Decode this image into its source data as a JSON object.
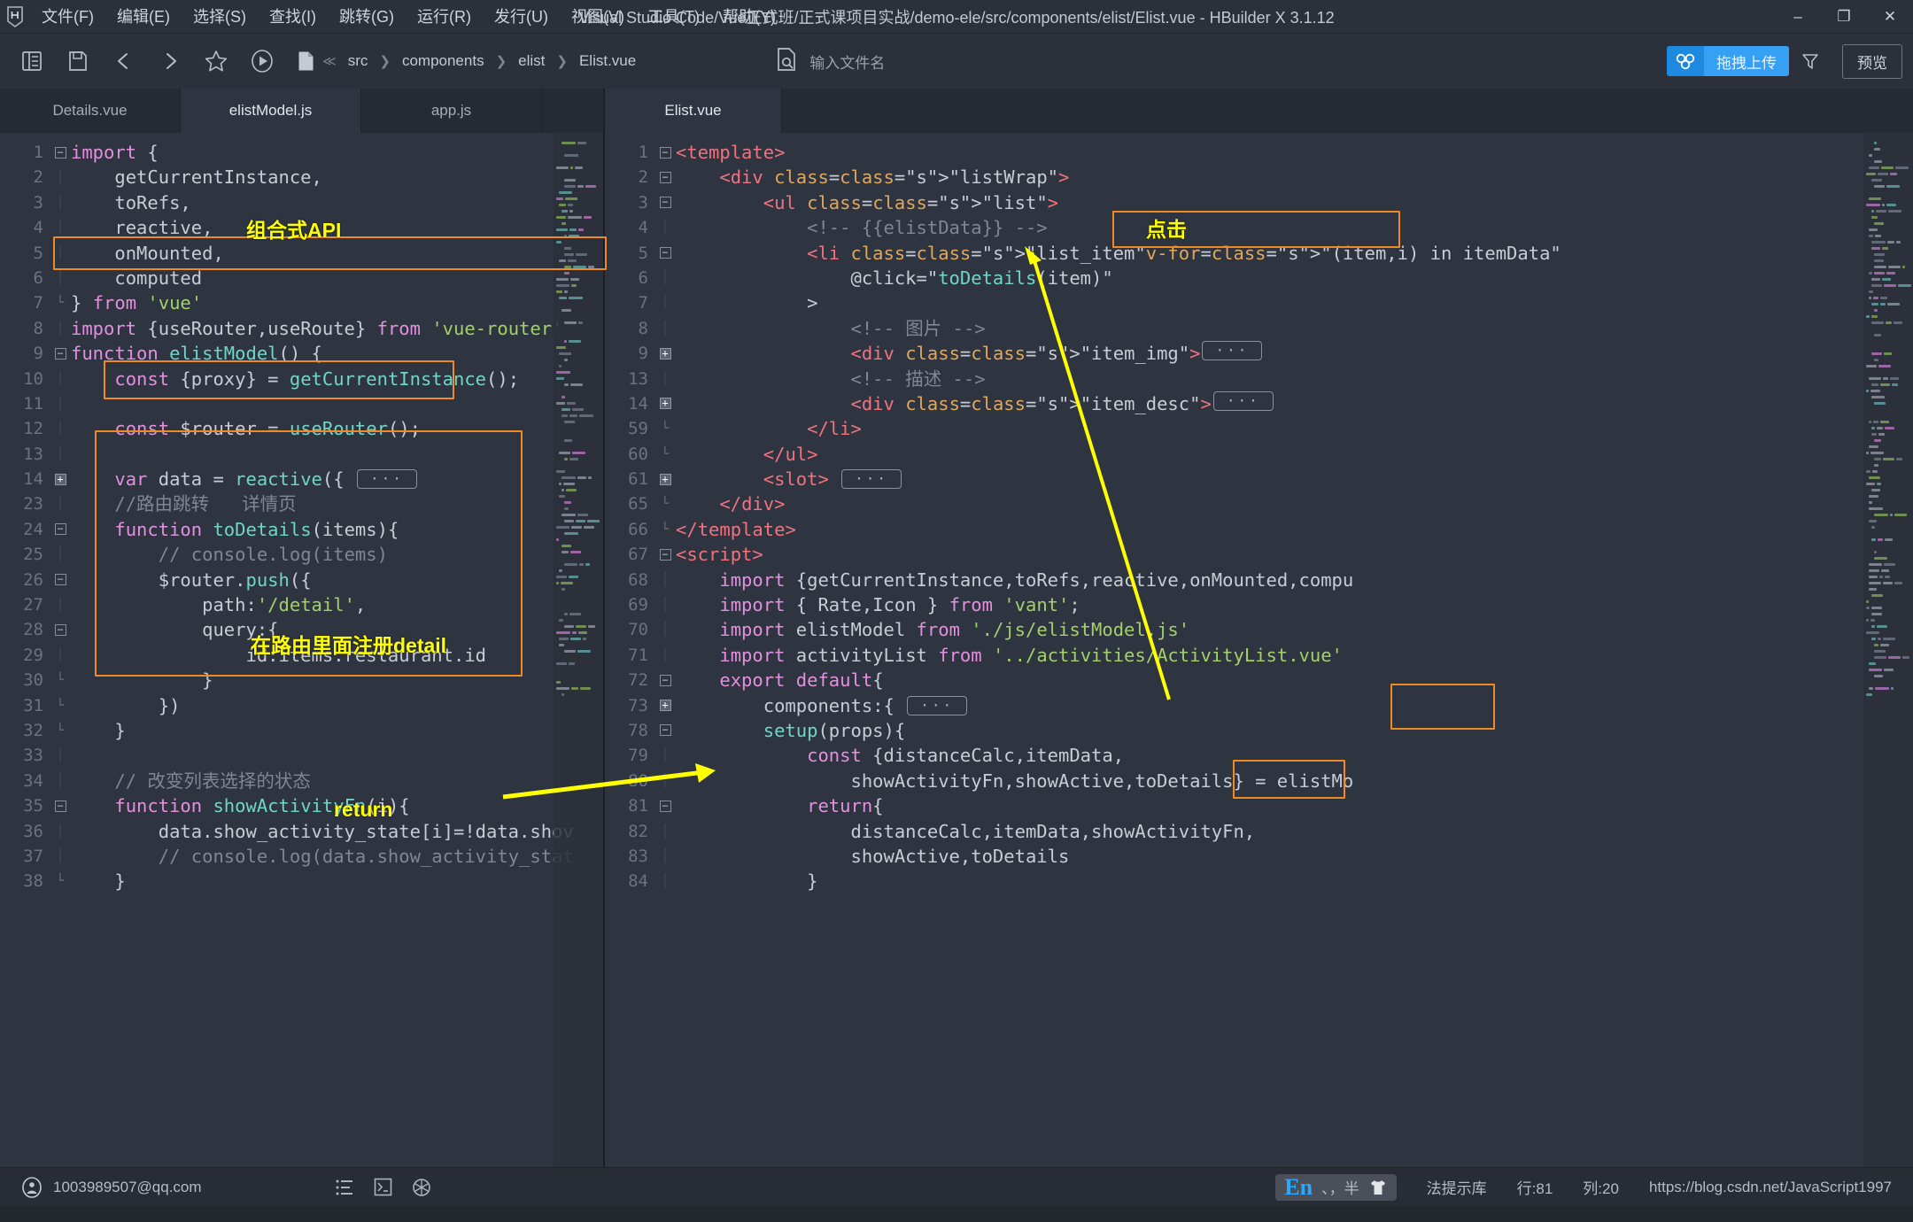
{
  "window": {
    "title": "Visual Studio Code/Vue正式班/正式课项目实战/demo-ele/src/components/elist/Elist.vue - HBuilder X 3.1.12",
    "minimize": "–",
    "maximize": "❐",
    "close": "✕"
  },
  "menu": [
    {
      "label": "文件(F)"
    },
    {
      "label": "编辑(E)"
    },
    {
      "label": "选择(S)"
    },
    {
      "label": "查找(I)"
    },
    {
      "label": "跳转(G)"
    },
    {
      "label": "运行(R)"
    },
    {
      "label": "发行(U)"
    },
    {
      "label": "视图(V)"
    },
    {
      "label": "工具(T)"
    },
    {
      "label": "帮助(Y)"
    }
  ],
  "toolbar": {
    "breadcrumb": [
      "src",
      "components",
      "elist",
      "Elist.vue"
    ],
    "breadcrumb_prefix": "≪",
    "search_placeholder": "输入文件名",
    "upload_label": "拖拽上传",
    "preview_label": "预览"
  },
  "left_pane": {
    "tabs": [
      {
        "label": "Details.vue",
        "active": false
      },
      {
        "label": "elistModel.js",
        "active": true
      },
      {
        "label": "app.js",
        "active": false
      }
    ],
    "lines": [
      {
        "n": "1",
        "fold": "minus",
        "code": "import {"
      },
      {
        "n": "2",
        "fold": "",
        "code": "    getCurrentInstance,"
      },
      {
        "n": "3",
        "fold": "",
        "code": "    toRefs,"
      },
      {
        "n": "4",
        "fold": "",
        "code": "    reactive,"
      },
      {
        "n": "5",
        "fold": "",
        "code": "    onMounted,"
      },
      {
        "n": "6",
        "fold": "",
        "code": "    computed"
      },
      {
        "n": "7",
        "fold": "end",
        "code": "} from 'vue'"
      },
      {
        "n": "8",
        "fold": "",
        "code": "import {useRouter,useRoute} from 'vue-router'"
      },
      {
        "n": "9",
        "fold": "minus",
        "code": "function elistModel() {"
      },
      {
        "n": "10",
        "fold": "",
        "code": "    const {proxy} = getCurrentInstance();"
      },
      {
        "n": "11",
        "fold": "",
        "code": ""
      },
      {
        "n": "12",
        "fold": "",
        "code": "    const $router = useRouter();"
      },
      {
        "n": "13",
        "fold": "",
        "code": ""
      },
      {
        "n": "14",
        "fold": "plus",
        "code": "    var data = reactive({ ⋯"
      },
      {
        "n": "23",
        "fold": "",
        "code": "    //路由跳转   详情页"
      },
      {
        "n": "24",
        "fold": "minus",
        "code": "    function toDetails(items){"
      },
      {
        "n": "25",
        "fold": "",
        "code": "        // console.log(items)"
      },
      {
        "n": "26",
        "fold": "minus",
        "code": "        $router.push({"
      },
      {
        "n": "27",
        "fold": "",
        "code": "            path:'/detail',"
      },
      {
        "n": "28",
        "fold": "minus",
        "code": "            query:{"
      },
      {
        "n": "29",
        "fold": "",
        "code": "                id:items.restaurant.id"
      },
      {
        "n": "30",
        "fold": "end",
        "code": "            }"
      },
      {
        "n": "31",
        "fold": "end",
        "code": "        })"
      },
      {
        "n": "32",
        "fold": "end",
        "code": "    }"
      },
      {
        "n": "33",
        "fold": "",
        "code": ""
      },
      {
        "n": "34",
        "fold": "",
        "code": "    // 改变列表选择的状态"
      },
      {
        "n": "35",
        "fold": "minus",
        "code": "    function showActivityFn(i){"
      },
      {
        "n": "36",
        "fold": "",
        "code": "        data.show_activity_state[i]=!data.shov"
      },
      {
        "n": "37",
        "fold": "",
        "code": "        // console.log(data.show_activity_stat"
      },
      {
        "n": "38",
        "fold": "end",
        "code": "    }"
      }
    ],
    "annotations": [
      {
        "text": "组合式API"
      },
      {
        "text": "在路由里面注册detail"
      },
      {
        "text": "return"
      }
    ]
  },
  "right_pane": {
    "tabs": [
      {
        "label": "Elist.vue",
        "active": true
      }
    ],
    "lines": [
      {
        "n": "1",
        "fold": "minus",
        "code": "<template>"
      },
      {
        "n": "2",
        "fold": "minus",
        "code": "    <div class=\"listWrap\">"
      },
      {
        "n": "3",
        "fold": "minus",
        "code": "        <ul class=\"list\">"
      },
      {
        "n": "4",
        "fold": "",
        "code": "            <!-- {{elistData}} -->"
      },
      {
        "n": "5",
        "fold": "minus",
        "code": "            <li class=\"list_item\" v-for=\"(item,i) in itemData\""
      },
      {
        "n": "6",
        "fold": "",
        "code": "                @click=\"toDetails(item)\""
      },
      {
        "n": "7",
        "fold": "",
        "code": "            >"
      },
      {
        "n": "8",
        "fold": "",
        "code": "                <!-- 图片 -->"
      },
      {
        "n": "9",
        "fold": "plus",
        "code": "                <div class=\"item_img\"> ⋯"
      },
      {
        "n": "13",
        "fold": "",
        "code": "                <!-- 描述 -->"
      },
      {
        "n": "14",
        "fold": "plus",
        "code": "                <div class=\"item_desc\"> ⋯"
      },
      {
        "n": "59",
        "fold": "end",
        "code": "            </li>"
      },
      {
        "n": "60",
        "fold": "end",
        "code": "        </ul>"
      },
      {
        "n": "61",
        "fold": "plus",
        "code": "        <slot> ⋯"
      },
      {
        "n": "65",
        "fold": "end",
        "code": "    </div>"
      },
      {
        "n": "66",
        "fold": "end",
        "code": "</template>"
      },
      {
        "n": "67",
        "fold": "minus",
        "code": "<script>"
      },
      {
        "n": "68",
        "fold": "",
        "code": "    import {getCurrentInstance,toRefs,reactive,onMounted,compu"
      },
      {
        "n": "69",
        "fold": "",
        "code": "    import { Rate,Icon } from 'vant';"
      },
      {
        "n": "70",
        "fold": "",
        "code": "    import elistModel from './js/elistModel.js'"
      },
      {
        "n": "71",
        "fold": "",
        "code": "    import activityList from '../activities/ActivityList.vue'"
      },
      {
        "n": "72",
        "fold": "minus",
        "code": "    export default{"
      },
      {
        "n": "73",
        "fold": "plus",
        "code": "        components:{ ⋯"
      },
      {
        "n": "78",
        "fold": "minus",
        "code": "        setup(props){"
      },
      {
        "n": "79",
        "fold": "",
        "code": "            const {distanceCalc,itemData,"
      },
      {
        "n": "80",
        "fold": "",
        "code": "                showActivityFn,showActive,toDetails} = elistMo"
      },
      {
        "n": "81",
        "fold": "minus",
        "code": "            return{"
      },
      {
        "n": "82",
        "fold": "",
        "code": "                distanceCalc,itemData,showActivityFn,"
      },
      {
        "n": "83",
        "fold": "",
        "code": "                showActive,toDetails"
      },
      {
        "n": "84",
        "fold": "",
        "code": "            }"
      }
    ],
    "annotations": [
      {
        "text": "点击"
      }
    ]
  },
  "statusbar": {
    "account": "1003989507@qq.com",
    "ime_en": "En",
    "ime_marks": "、，半",
    "hint_lib": "法提示库",
    "line": "行:81",
    "column": "列:20",
    "watermark": "https://blog.csdn.net/JavaScript1997"
  },
  "colors": {
    "accent_orange": "#f08a24",
    "accent_yellow": "#ffff00",
    "upload_blue": "#2196f3",
    "editor_bg": "#2e3440",
    "chrome_bg": "#2b303b"
  }
}
